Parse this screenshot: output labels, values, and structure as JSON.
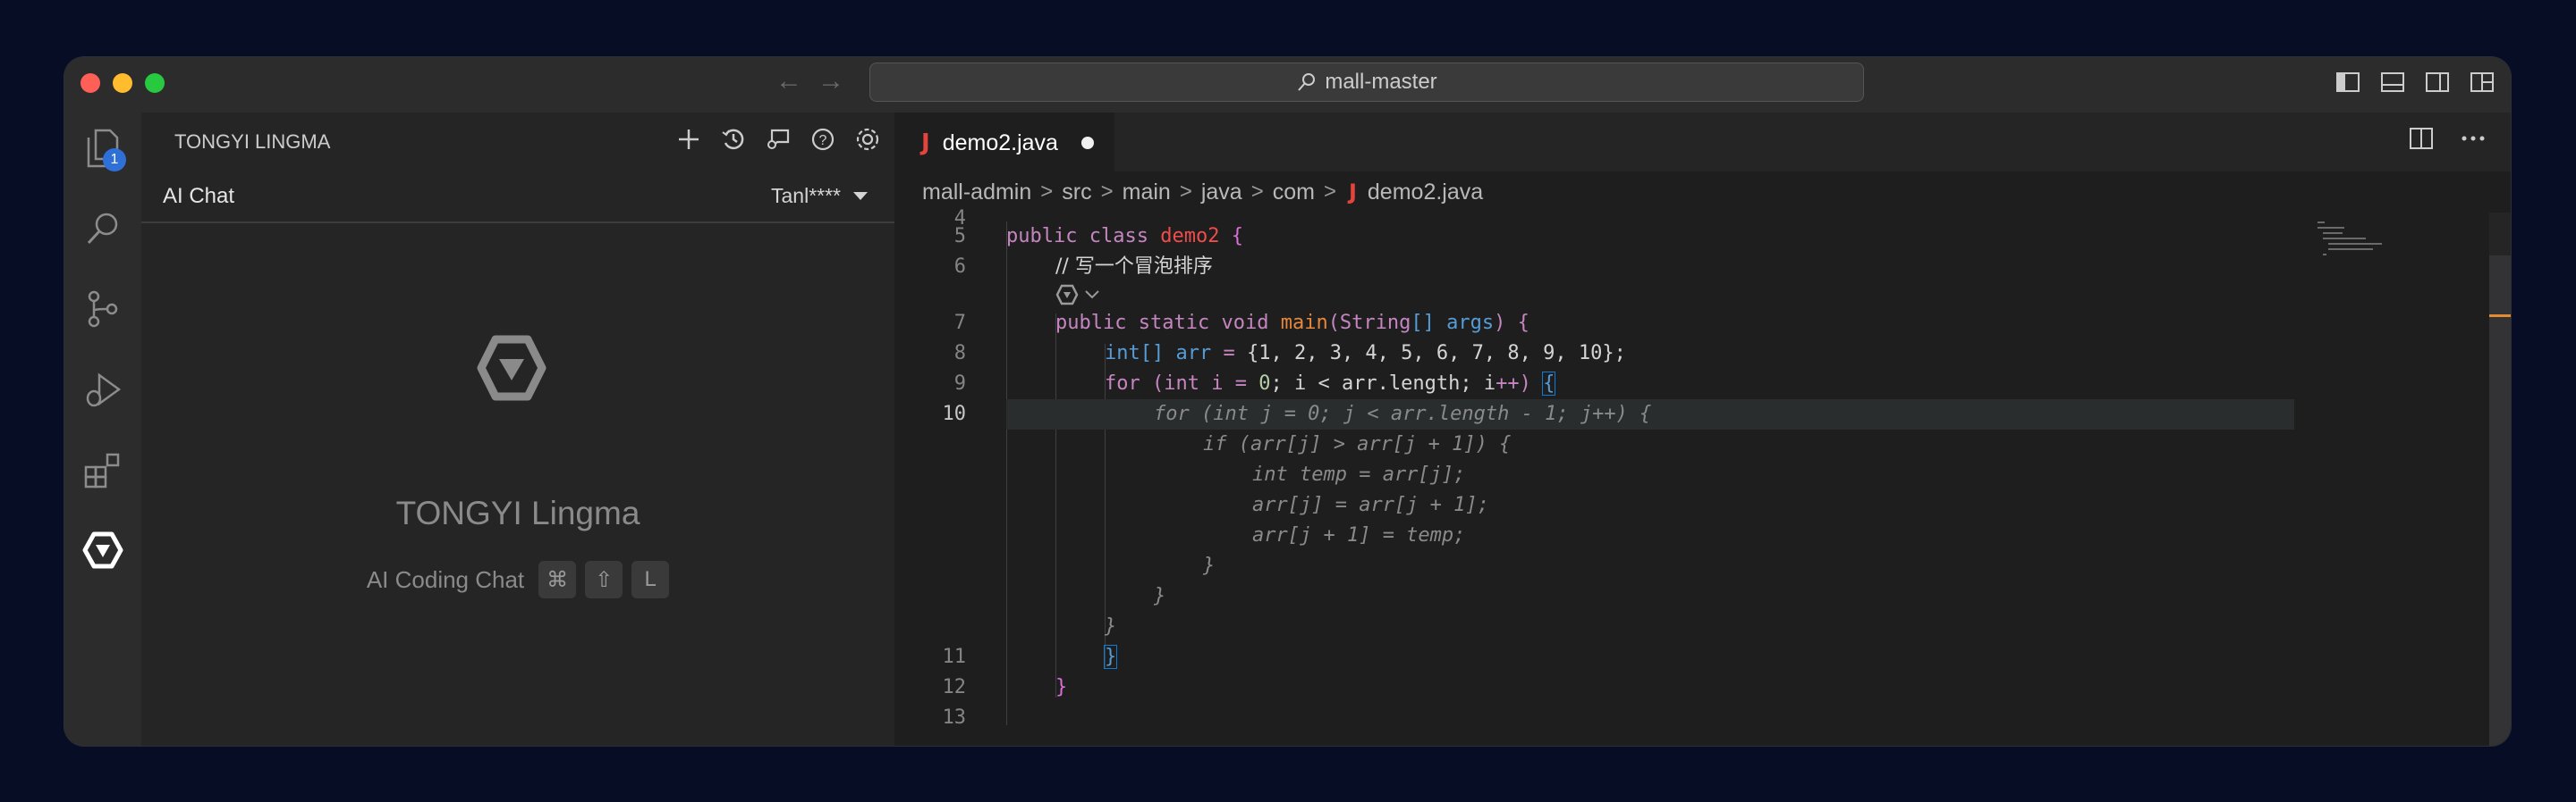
{
  "window": {
    "search_text": "mall-master"
  },
  "activity_bar": {
    "explorer_badge": "1"
  },
  "sidebar": {
    "title": "TONGYI LINGMA",
    "chat_title": "AI Chat",
    "account": "Tanl****",
    "brand": "TONGYI Lingma",
    "shortcut_label": "AI Coding Chat",
    "shortcut_keys": [
      "⌘",
      "⇧",
      "L"
    ]
  },
  "editor": {
    "tab_icon": "J",
    "tab_label": "demo2.java",
    "breadcrumb": [
      "mall-admin",
      "src",
      "main",
      "java",
      "com",
      "demo2.java"
    ],
    "line_numbers": [
      "4",
      "5",
      "6",
      "7",
      "8",
      "9",
      "10",
      "11",
      "12",
      "13"
    ],
    "code": {
      "l5_kw1": "public",
      "l5_kw2": "class",
      "l5_cls": "demo2",
      "l5_brace": "{",
      "l6_comment": "// 写一个冒泡排序",
      "l7_kw1": "public",
      "l7_kw2": "static",
      "l7_kw3": "void",
      "l7_fn": "main",
      "l7_args_a": "(String",
      "l7_args_b": "[]",
      "l7_args_c": "args",
      "l7_args_d": ") {",
      "l8_type": "int[]",
      "l8_var": "arr",
      "l8_eq": "=",
      "l8_vals": "{1, 2, 3, 4, 5, 6, 7, 8, 9, 10};",
      "l9_for": "for",
      "l9_rest_a": "(int i = ",
      "l9_zero": "0",
      "l9_rest_b": "; i < arr.length; i",
      "l9_inc": "++",
      "l9_close": ")",
      "l9_brace": "{",
      "g1": "for (int j = 0; j < arr.length - 1; j++) {",
      "g2": "if (arr[j] > arr[j + 1]) {",
      "g3": "int temp = arr[j];",
      "g4": "arr[j] = arr[j + 1];",
      "g5": "arr[j + 1] = temp;",
      "g6": "}",
      "g7": "}",
      "g8": "}",
      "l11_brace": "}",
      "l12_brace": "}"
    }
  },
  "colors": {
    "background": "#070d24",
    "accent_blue": "#2f6fd8",
    "java_red": "#e4443b"
  }
}
